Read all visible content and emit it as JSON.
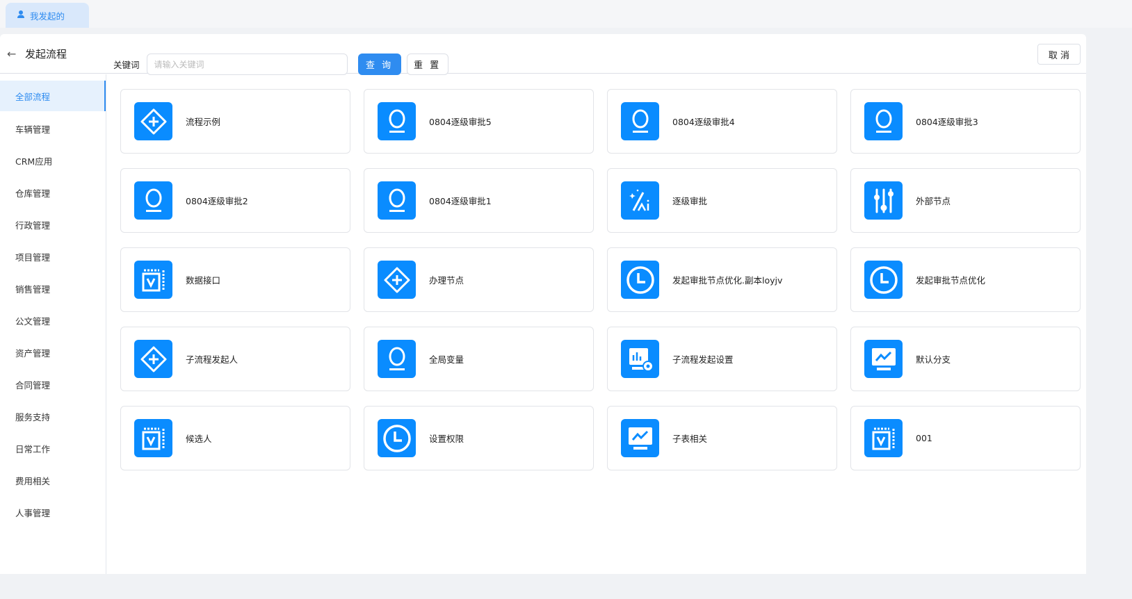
{
  "tab": {
    "label": "我发起的",
    "icon": "user-icon"
  },
  "header": {
    "title": "发起流程",
    "cancel": "取 消"
  },
  "sidebar": {
    "items": [
      "全部流程",
      "车辆管理",
      "CRM应用",
      "仓库管理",
      "行政管理",
      "项目管理",
      "销售管理",
      "公文管理",
      "资产管理",
      "合同管理",
      "服务支持",
      "日常工作",
      "费用相关",
      "人事管理"
    ]
  },
  "search": {
    "label": "关键词",
    "placeholder": "请输入关键词",
    "query": "查 询",
    "reset": "重 置"
  },
  "accent": "#0a8cff",
  "cards": [
    {
      "name": "流程示例",
      "icon": "plus-diamond"
    },
    {
      "name": "0804逐级审批5",
      "icon": "lamp"
    },
    {
      "name": "0804逐级审批4",
      "icon": "lamp"
    },
    {
      "name": "0804逐级审批3",
      "icon": "lamp"
    },
    {
      "name": "0804逐级审批2",
      "icon": "lamp"
    },
    {
      "name": "0804逐级审批1",
      "icon": "lamp"
    },
    {
      "name": "逐级审批",
      "icon": "ai"
    },
    {
      "name": "外部节点",
      "icon": "sliders"
    },
    {
      "name": "数据接口",
      "icon": "v-box"
    },
    {
      "name": "办理节点",
      "icon": "plus-diamond"
    },
    {
      "name": "发起审批节点优化.副本loyjv",
      "icon": "clock"
    },
    {
      "name": "发起审批节点优化",
      "icon": "clock"
    },
    {
      "name": "子流程发起人",
      "icon": "plus-diamond"
    },
    {
      "name": "全局变量",
      "icon": "lamp"
    },
    {
      "name": "子流程发起设置",
      "icon": "chart-gear"
    },
    {
      "name": "默认分支",
      "icon": "monitor-chart"
    },
    {
      "name": "候选人",
      "icon": "v-box"
    },
    {
      "name": "设置权限",
      "icon": "clock"
    },
    {
      "name": "子表相关",
      "icon": "monitor-chart"
    },
    {
      "name": "001",
      "icon": "v-box"
    }
  ]
}
